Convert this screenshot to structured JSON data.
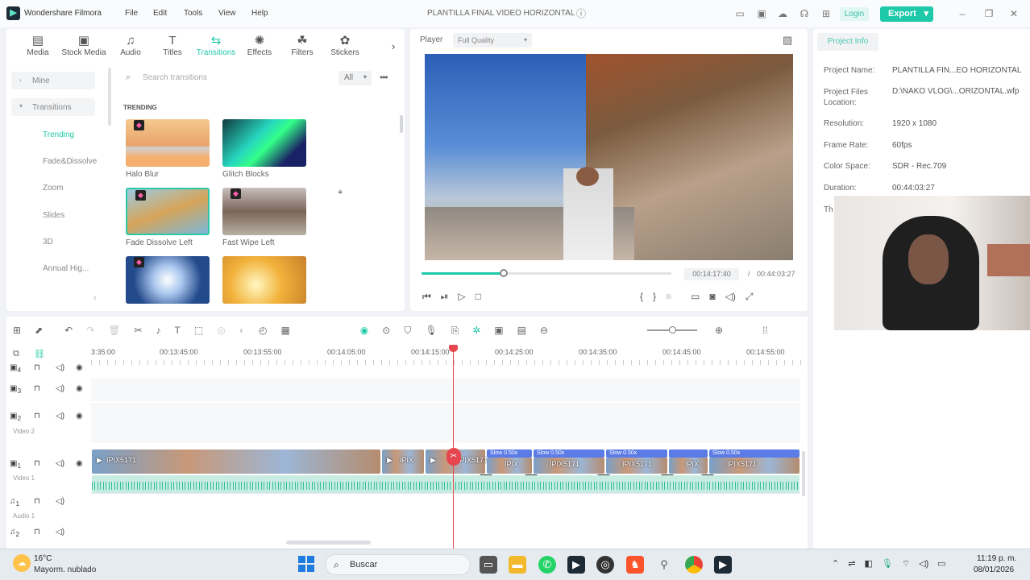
{
  "titlebar": {
    "app_name": "Wondershare Filmora",
    "menus": [
      "File",
      "Edit",
      "Tools",
      "View",
      "Help"
    ],
    "project_title": "PLANTILLA FINAL VIDEO HORIZONTAL",
    "login": "Login",
    "export": "Export"
  },
  "media_tabs": [
    "Media",
    "Stock Media",
    "Audio",
    "Titles",
    "Transitions",
    "Effects",
    "Filters",
    "Stickers"
  ],
  "active_tab": "Transitions",
  "sidebar": {
    "mine": "Mine",
    "transitions": "Transitions",
    "items": [
      "Trending",
      "Fade&Dissolve",
      "Zoom",
      "Slides",
      "3D",
      "Annual Hig..."
    ]
  },
  "search": {
    "placeholder": "Search transitions",
    "filter": "All"
  },
  "library": {
    "section": "TRENDING",
    "items": [
      "Halo Blur",
      "Glitch Blocks",
      "Fade Dissolve Left",
      "Fast Wipe Left"
    ]
  },
  "player": {
    "label": "Player",
    "quality": "Full Quality",
    "current_time": "00:14:17:40",
    "total_time": "00:44:03:27",
    "progress": 0.33
  },
  "project_info": {
    "tab": "Project Info",
    "rows": [
      {
        "key": "Project Name:",
        "value": "PLANTILLA FIN...EO HORIZONTAL"
      },
      {
        "key": "Project Files Location:",
        "value": "D:\\NAKO VLOG\\...ORIZONTAL.wfp"
      },
      {
        "key": "Resolution:",
        "value": "1920 x 1080"
      },
      {
        "key": "Frame Rate:",
        "value": "60fps"
      },
      {
        "key": "Color Space:",
        "value": "SDR - Rec.709"
      },
      {
        "key": "Duration:",
        "value": "00:44:03:27"
      }
    ],
    "cut_label": "Th"
  },
  "timeline": {
    "ruler": [
      "3:35:00",
      "00:13:45:00",
      "00:13:55:00",
      "00:14:05:00",
      "00:14:15:00",
      "00:14:25:00",
      "00:14:35:00",
      "00:14:45:00",
      "00:14:55:00"
    ],
    "tracks": [
      {
        "num": "4",
        "label": ""
      },
      {
        "num": "3",
        "label": ""
      },
      {
        "num": "2",
        "label": "Video 2"
      },
      {
        "num": "1",
        "label": "Video 1"
      },
      {
        "num": "1",
        "label": "Audio 1"
      },
      {
        "num": "2",
        "label": ""
      }
    ],
    "clip_labels": [
      "IPIX5171",
      "IPIX",
      "IPIX5171",
      "IPIX",
      "IPIX5171",
      "IPIX5171",
      "IPIX",
      "IPIX5171"
    ],
    "slow_labels": [
      "Slow 0.50x",
      "Slow 0.50x",
      "Slow 0.50x",
      "Slow 0.50x"
    ]
  },
  "taskbar": {
    "temp": "16°C",
    "weather": "Mayorm. nublado",
    "search": "Buscar",
    "time": "11:19 p. m.",
    "date": "08/01/2026"
  },
  "colors": {
    "accent": "#1ec9a9",
    "playhead": "#e5464f",
    "slow_bar": "#5b7be6"
  }
}
